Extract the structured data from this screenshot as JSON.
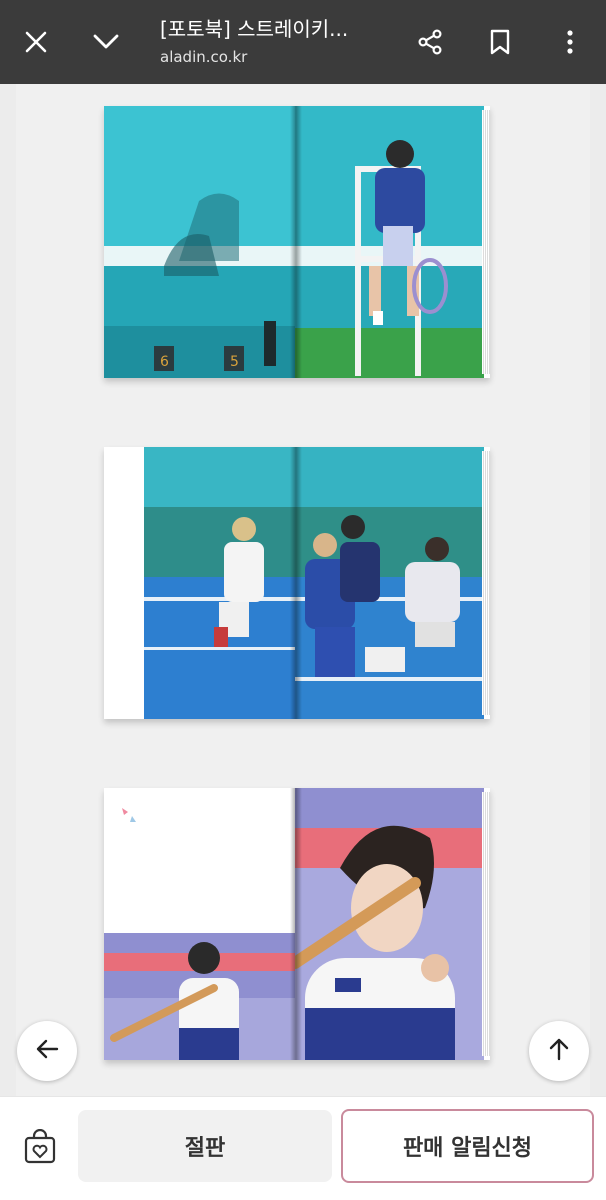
{
  "browser": {
    "title": "[포토북] 스트레이키...",
    "url": "aladin.co.kr",
    "icons": {
      "close": "close-icon",
      "collapse": "chevron-down-icon",
      "share": "share-icon",
      "bookmark": "bookmark-icon",
      "more": "more-vert-icon"
    }
  },
  "gallery": {
    "images": [
      {
        "name": "photobook-spread-1"
      },
      {
        "name": "photobook-spread-2"
      },
      {
        "name": "photobook-spread-3"
      }
    ]
  },
  "floating": {
    "back_icon": "arrow-left-icon",
    "top_icon": "arrow-up-icon"
  },
  "bottom": {
    "wish_icon": "heart-bag-icon",
    "soldout_label": "절판",
    "notify_label": "판매 알림신청",
    "notify_border_color": "#c98a9c"
  }
}
